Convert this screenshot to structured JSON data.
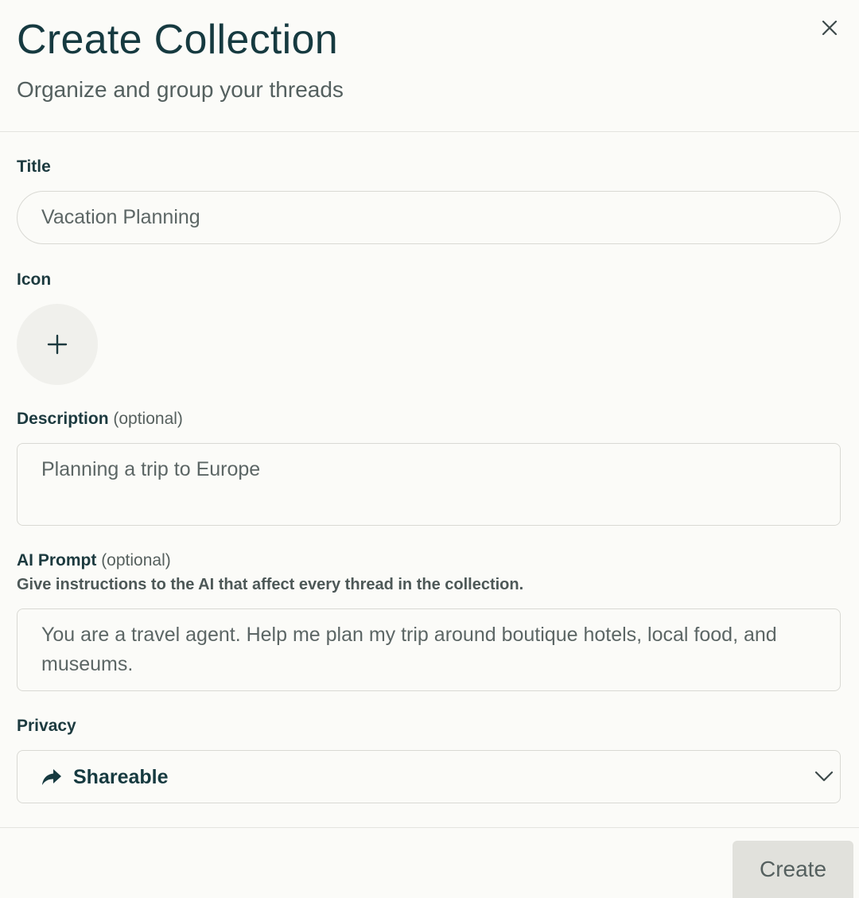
{
  "dialog": {
    "title": "Create Collection",
    "subtitle": "Organize and group your threads",
    "close_icon": "close-icon"
  },
  "fields": {
    "title": {
      "label": "Title",
      "value": "Vacation Planning"
    },
    "icon": {
      "label": "Icon",
      "picker_icon": "plus-icon"
    },
    "description": {
      "label": "Description",
      "optional": "(optional)",
      "value": "Planning a trip to Europe"
    },
    "ai_prompt": {
      "label": "AI Prompt",
      "optional": "(optional)",
      "hint": "Give instructions to the AI that affect every thread in the collection.",
      "value": "You are a travel agent. Help me plan my trip around boutique hotels, local food, and museums."
    },
    "privacy": {
      "label": "Privacy",
      "selected": "Shareable",
      "selected_icon": "share-arrow-icon",
      "dropdown_icon": "chevron-down-icon"
    }
  },
  "footer": {
    "create_label": "Create"
  },
  "colors": {
    "background": "#fbfbf8",
    "text_primary": "#163a40",
    "border": "#d9d9d4",
    "button_disabled_bg": "#e1e1dc"
  }
}
